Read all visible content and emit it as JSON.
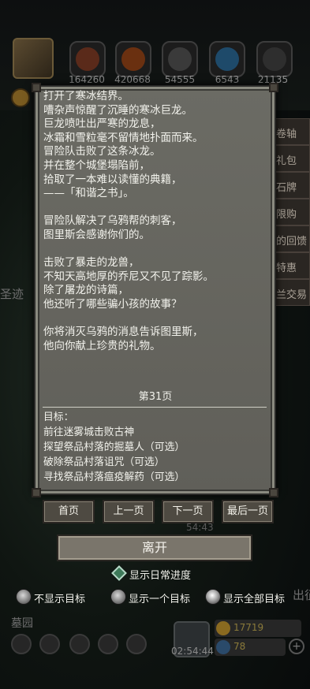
{
  "resources": [
    "164260",
    "420668",
    "54555",
    "6543",
    "21135"
  ],
  "side_menu": [
    "卷轴",
    "礼包",
    "石牌",
    "限购",
    "的回馈",
    "特惠",
    "兰交易"
  ],
  "background_text": {
    "left": "圣迹",
    "right": "出征",
    "bottom_left": "墓园",
    "mid_timer": "54:43",
    "bottom_timer": "02:54:44"
  },
  "currency": [
    "17719",
    "78"
  ],
  "book": {
    "paragraphs": [
      [
        "打开了寒冰结界。",
        "嘈杂声惊醒了沉睡的寒冰巨龙。",
        "巨龙喷吐出严寒的龙息，",
        "冰霜和雪粒毫不留情地扑面而来。",
        "冒险队击败了这条冰龙。",
        "并在整个城堡塌陷前，",
        "拾取了一本难以读懂的典籍，",
        "——「和谐之书」。"
      ],
      [
        "冒险队解决了乌鸦帮的刺客，",
        "图里斯会感谢你们的。"
      ],
      [
        "击败了暴走的龙兽，",
        "不知天高地厚的乔尼又不见了踪影。",
        "除了屠龙的诗篇，",
        "他还听了哪些骗小孩的故事？"
      ],
      [
        "你将消灭乌鸦的消息告诉图里斯，",
        "他向你献上珍贵的礼物。"
      ]
    ],
    "page_label": "第31页",
    "goals_title": "目标：",
    "goals": [
      "前往迷雾城击败古神",
      "探望祭品村落的掘墓人（可选）",
      "破除祭品村落诅咒（可选）",
      "寻找祭品村落瘟疫解药（可选）"
    ]
  },
  "nav": {
    "first": "首页",
    "prev": "上一页",
    "next": "下一页",
    "last": "最后一页"
  },
  "leave_label": "离开",
  "daily_progress_label": "显示日常进度",
  "goal_options": [
    "不显示目标",
    "显示一个目标",
    "显示全部目标"
  ],
  "goal_option_selected": 2,
  "colors": {
    "page_bg": "#64635d",
    "button_bg": "#4e4a42",
    "leave_bg": "#7a756b",
    "diamond": "#3e7a5a"
  }
}
